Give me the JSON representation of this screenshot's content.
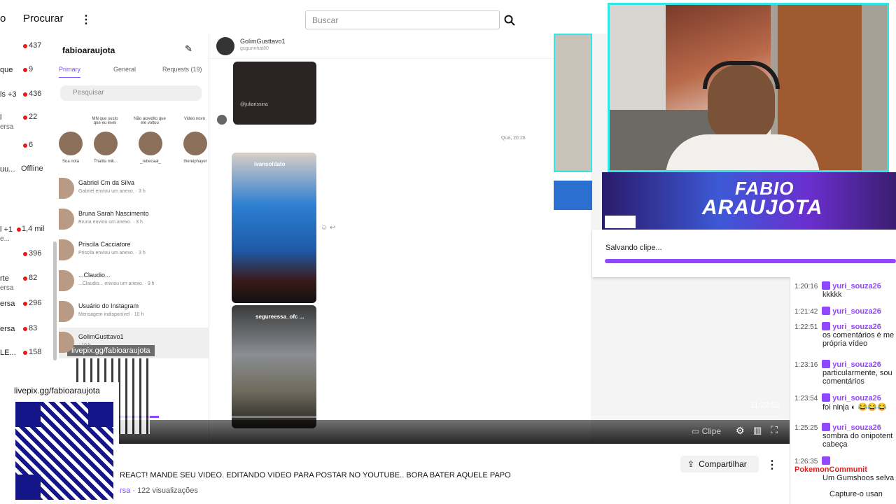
{
  "nav": {
    "left_truncated": "o",
    "browse": "Procurar",
    "search_placeholder": "Buscar"
  },
  "channels": [
    {
      "name": "",
      "count": "437",
      "sub": ""
    },
    {
      "name": "que",
      "count": "9",
      "sub": ""
    },
    {
      "name": "ls +3",
      "count": "436",
      "sub": ""
    },
    {
      "name": "l",
      "count": "22",
      "sub": "ersa"
    },
    {
      "name": "",
      "count": "6",
      "sub": ""
    },
    {
      "name": "uu...",
      "count": "Offline",
      "sub": ""
    },
    {
      "name": "l +1",
      "count": "1,4 mil",
      "sub": "e..."
    },
    {
      "name": "",
      "count": "396",
      "sub": ""
    },
    {
      "name": "rte",
      "count": "82",
      "sub": "ersa"
    },
    {
      "name": "ersa",
      "count": "296",
      "sub": ""
    },
    {
      "name": "ersa",
      "count": "83",
      "sub": ""
    },
    {
      "name": "LE...",
      "count": "158",
      "sub": ""
    }
  ],
  "instagram": {
    "account": "fabioaraujota",
    "tabs": [
      "Primary",
      "General",
      "Requests (19)"
    ],
    "search_placeholder": "Pesquisar",
    "stories": [
      {
        "caption": "",
        "name": "Sua nota"
      },
      {
        "caption": "MN que susto que eu levei",
        "name": "Thalita mik..."
      },
      {
        "caption": "Não acredito que ele voltou",
        "name": "_rebecaal_"
      },
      {
        "caption": "Video novo",
        "name": "thereiphayer"
      }
    ],
    "conversations": [
      {
        "name": "Gabriel Cm da Silva",
        "msg": "Gabriel enviou um anexo. · 3 h"
      },
      {
        "name": "Bruna Sarah Nascimento",
        "msg": "Bruna enviou um anexo. · 3 h"
      },
      {
        "name": "Priscila Cacciatore",
        "msg": "Priscila enviou um anexo. · 3 h"
      },
      {
        "name": "...Claudio...",
        "msg": "...Claudio... enviou um anexo. · 9 h"
      },
      {
        "name": "Usuário do Instagram",
        "msg": "Mensagem indisponível · 10 h"
      },
      {
        "name": "GolimGusttavo1",
        "msg": "· 10 h"
      }
    ],
    "thread_user": "GolimGusttavo1",
    "thread_handle": "gugurinhat80",
    "timestamp": "Qua, 20:26",
    "reel_1": "ivansoldato",
    "reel_2": "segureessa_ofc ...",
    "watermark": "@juliarissina"
  },
  "overlay": {
    "banner_line1": "FABIO",
    "banner_line2": "ARAUJOTA",
    "clip_status": "Salvando clipe...",
    "clip_progress": 1.0,
    "qr_small_label": "livepix.gg/fabioaraujota",
    "qr_big_label": "livepix.gg/fabioaraujota"
  },
  "player": {
    "time": "11:23:52",
    "clip_label": "Clipe",
    "progress": 0.06
  },
  "video_info": {
    "title": "REACT! MANDE SEU VIDEO. EDITANDO VIDEO PARA POSTAR NO YOUTUBE.. BORA BATER AQUELE PAPO",
    "category_prefix": "rsa",
    "views": "· 122 visualizações",
    "share": "Compartilhar"
  },
  "chat": [
    {
      "time": "1:20:16",
      "user": "yuri_souza26",
      "msg": "kkkkk"
    },
    {
      "time": "1:21:42",
      "user": "yuri_souza26",
      "msg": ""
    },
    {
      "time": "1:22:51",
      "user": "yuri_souza26",
      "msg": "os comentários é me própria vídeo"
    },
    {
      "time": "1:23:16",
      "user": "yuri_souza26",
      "msg": "particularmente, sou comentários"
    },
    {
      "time": "1:23:54",
      "user": "yuri_souza26",
      "msg": "foi ninja ◐ 😂😂😂"
    },
    {
      "time": "1:25:25",
      "user": "yuri_souza26",
      "msg": "sombra do onipotent cabeça"
    },
    {
      "time": "1:26:35",
      "user": "PokemonCommunit",
      "msg": "Um Gumshoos selva"
    },
    {
      "time": "",
      "user": "",
      "msg": "Capture-o usan"
    }
  ],
  "colors": {
    "accent": "#9146ff",
    "cam_border": "#33e6e6",
    "live_dot": "#e91916"
  }
}
